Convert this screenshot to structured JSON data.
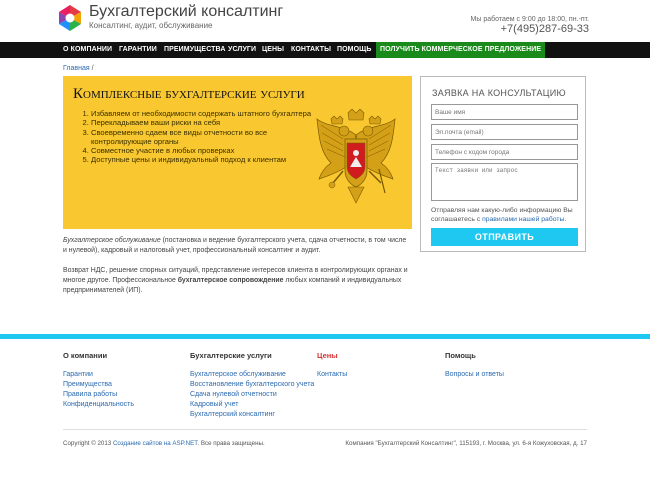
{
  "header": {
    "brand_title": "Бухгалтерский консалтинг",
    "brand_subtitle": "Консалтинг, аудит, обслуживание",
    "work_hours": "Мы работаем с 9:00 до 18:00, пн.-пт.",
    "phone": "+7(495)287-69-33",
    "logo_colors": [
      "#e63946",
      "#f4a300",
      "#2bb24c",
      "#1e90ff",
      "#8e44ad"
    ]
  },
  "nav": {
    "items": [
      {
        "label": "О КОМПАНИИ"
      },
      {
        "label": "ГАРАНТИИ"
      },
      {
        "label": "ПРЕИМУЩЕСТВА"
      },
      {
        "label": "УСЛУГИ"
      },
      {
        "label": "ЦЕНЫ"
      },
      {
        "label": "КОНТАКТЫ"
      },
      {
        "label": "ПОМОЩЬ"
      }
    ],
    "cta_label": "ПОЛУЧИТЬ КОММЕРЧЕСКОЕ ПРЕДЛОЖЕНИЕ",
    "cta_color": "#1a8a1a"
  },
  "breadcrumb": {
    "home": "Главная",
    "separator": " /"
  },
  "hero": {
    "title": "Комплексные бухгалтерские услуги",
    "list": [
      "Избавляем от необходимости содержать штатного бухгалтера",
      "Перекладываем ваши риски на себя",
      "Своевременно сдаем все виды отчетности во все контролирующие органы",
      "Совместное участие в любых проверках",
      "Доступные цены и индивидуальный подход к клиентам"
    ],
    "emblem_icon": "russian-coat-of-arms-icon",
    "background": "#f9c72f"
  },
  "description": {
    "p1_em": "Бухгалтерское обслуживание",
    "p1_rest": " (постановка и ведение бухгалтерского учета, сдача отчетности, в том числе и нулевой), кадровый и налоговый учет, профессиональный консалтинг и аудит.",
    "p2_start": "Возврат НДС, решение спорных ситуаций, представление интересов клиента в контролирующих органах и многое другое. Профессиональное ",
    "p2_strong": "бухгалтерское сопровождение",
    "p2_end": " любых компаний и индивидуальных предпринимателей (ИП)."
  },
  "form": {
    "title": "ЗАЯВКА НА КОНСУЛЬТАЦИЮ",
    "name_placeholder": "Ваше имя",
    "email_placeholder": "Эл.почта (email)",
    "phone_placeholder": "Телефон с кодом города",
    "message_placeholder": "Текст заявки или запрос",
    "note_text": "Отправляя нам какую-либо информацию Вы соглашаетесь с ",
    "note_link": "правилами нашей работы",
    "note_end": ".",
    "submit_label": "ОТПРАВИТЬ",
    "submit_color": "#1ec8f0"
  },
  "footer": {
    "columns": [
      {
        "title": "О компании",
        "links": [
          "Гарантии",
          "Преимущества",
          "Правила работы",
          "Конфиденциальность"
        ]
      },
      {
        "title": "Бухгалтерские услуги",
        "links": [
          "Бухгалтерское обслуживание",
          "Восстановление бухгалтерского учета",
          "Сдача нулевой отчетности",
          "Кадровый учет",
          "Бухгалтерский консалтинг"
        ]
      },
      {
        "title": "Цены",
        "links": [
          "Контакты"
        ]
      },
      {
        "title": "Помощь",
        "links": [
          "Вопросы и ответы"
        ]
      }
    ],
    "copyright_text": "Copyright © 2013 ",
    "copyright_link": "Создание сайтов на ASP.NET",
    "copyright_end": ". Все права защищены.",
    "address": "Компания \"Бухгалтерский Консалтинг\", 115193, г. Москва, ул. 6-я Кожуховская, д. 17",
    "accent_color": "#1ec8f0"
  }
}
